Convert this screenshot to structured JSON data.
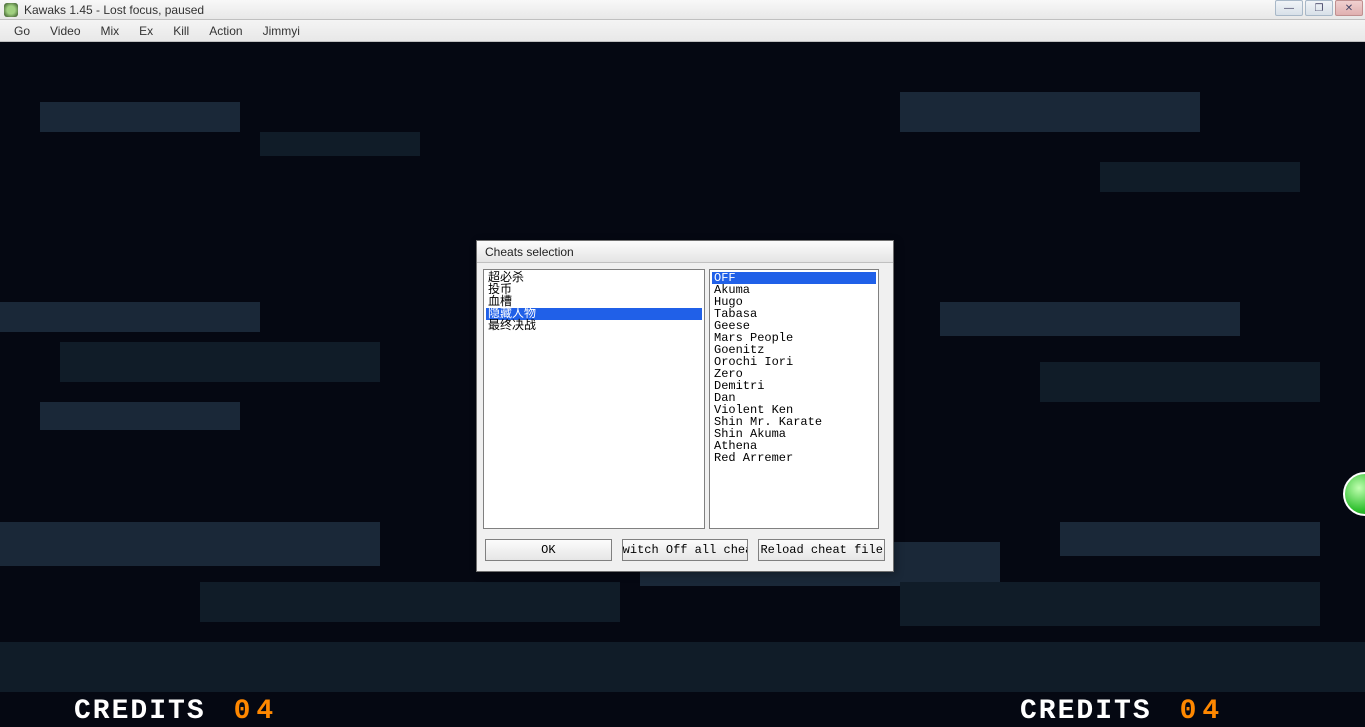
{
  "window": {
    "title": "Kawaks 1.45 - Lost focus, paused"
  },
  "menu": {
    "items": [
      "Go",
      "Video",
      "Mix",
      "Ex",
      "Kill",
      "Action",
      "Jimmyi"
    ]
  },
  "dialog": {
    "title": "Cheats selection",
    "left_list": {
      "items": [
        "超必杀",
        "投币",
        "血槽",
        "隐藏人物",
        "最终决战"
      ],
      "selected_index": 3
    },
    "right_list": {
      "items": [
        "OFF",
        "Akuma",
        "Hugo",
        "Tabasa",
        "Geese",
        "Mars People",
        "Goenitz",
        "Orochi Iori",
        "Zero",
        "Demitri",
        "Dan",
        "Violent Ken",
        "Shin Mr. Karate",
        "Shin Akuma",
        "Athena",
        "Red Arremer"
      ],
      "selected_index": 0
    },
    "buttons": {
      "ok": "OK",
      "switch_off": "witch Off all cheat",
      "reload": "Reload cheat file"
    }
  },
  "credits": {
    "left_label": "CREDITS",
    "left_value": "04",
    "right_label": "CREDITS",
    "right_value": "04"
  }
}
